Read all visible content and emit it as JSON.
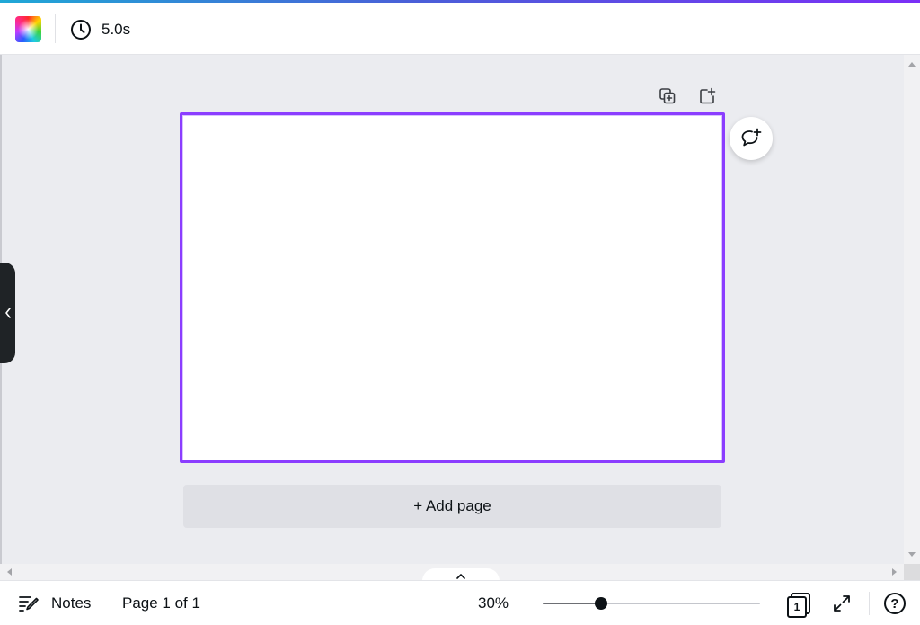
{
  "toolbar": {
    "duration": "5.0s"
  },
  "canvas": {
    "add_page_label": "+ Add page"
  },
  "footer": {
    "notes_label": "Notes",
    "page_indicator": "Page 1 of 1",
    "zoom_label": "30%",
    "zoom_value": 0.27,
    "pages_count": "1",
    "help_label": "?"
  },
  "colors": {
    "accent": "#8b3dff",
    "background": "#ebecf0",
    "text": "#0d1216"
  },
  "icons": {
    "duration": "clock-icon",
    "duplicate": "duplicate-page-icon",
    "add": "add-page-icon",
    "comment": "add-comment-icon",
    "notes": "notes-icon",
    "fullscreen": "fullscreen-icon",
    "help": "help-icon",
    "collapse": "chevron-left-icon",
    "expand": "chevron-up-icon"
  }
}
